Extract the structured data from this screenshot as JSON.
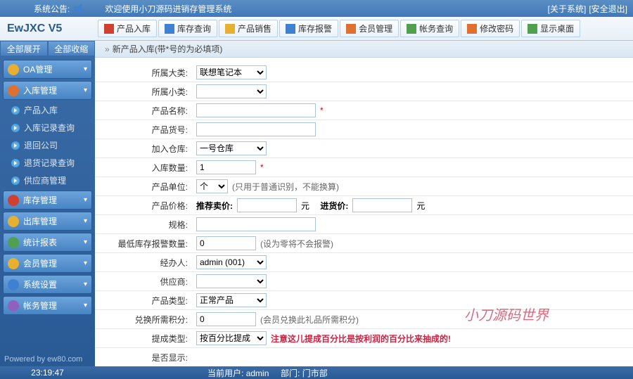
{
  "top": {
    "announce_label": "系统公告:",
    "welcome": "欢迎使用小刀源码进销存管理系统",
    "link_about": "[关于系统]",
    "link_exit": "[安全退出]"
  },
  "logo": "EwJXC  V5",
  "toolbar": [
    {
      "label": "产品入库",
      "name": "tb-product-in"
    },
    {
      "label": "库存查询",
      "name": "tb-stock-query"
    },
    {
      "label": "产品销售",
      "name": "tb-product-sale"
    },
    {
      "label": "库存报警",
      "name": "tb-stock-alarm"
    },
    {
      "label": "会员管理",
      "name": "tb-member"
    },
    {
      "label": "帐务查询",
      "name": "tb-account-query"
    },
    {
      "label": "修改密码",
      "name": "tb-change-pwd"
    },
    {
      "label": "显示桌面",
      "name": "tb-show-desktop"
    }
  ],
  "sb_toggle": {
    "expand": "全部展开",
    "collapse": "全部收缩"
  },
  "sidebar": [
    {
      "type": "group",
      "label": "OA管理",
      "name": "sb-oa"
    },
    {
      "type": "group",
      "label": "入库管理",
      "name": "sb-in"
    },
    {
      "type": "item",
      "label": "产品入库",
      "name": "sb-product-in"
    },
    {
      "type": "item",
      "label": "入库记录查询",
      "name": "sb-in-records"
    },
    {
      "type": "item",
      "label": "退回公司",
      "name": "sb-return"
    },
    {
      "type": "item",
      "label": "退货记录查询",
      "name": "sb-return-records"
    },
    {
      "type": "item",
      "label": "供应商管理",
      "name": "sb-supplier"
    },
    {
      "type": "group",
      "label": "库存管理",
      "name": "sb-stock"
    },
    {
      "type": "group",
      "label": "出库管理",
      "name": "sb-out"
    },
    {
      "type": "group",
      "label": "统计报表",
      "name": "sb-report"
    },
    {
      "type": "group",
      "label": "会员管理",
      "name": "sb-member"
    },
    {
      "type": "group",
      "label": "系统设置",
      "name": "sb-settings"
    },
    {
      "type": "group",
      "label": "帐务管理",
      "name": "sb-account"
    }
  ],
  "powered": "Powered by  ew80.com",
  "bread": {
    "title": "新产品入库(带*号的为必填项)"
  },
  "form": {
    "big_cat": {
      "label": "所属大类:",
      "value": "联想笔记本"
    },
    "small_cat": {
      "label": "所属小类:",
      "value": ""
    },
    "pname": {
      "label": "产品名称:",
      "value": ""
    },
    "pcode": {
      "label": "产品货号:",
      "value": ""
    },
    "warehouse": {
      "label": "加入仓库:",
      "value": "一号仓库"
    },
    "qty": {
      "label": "入库数量:",
      "value": "1"
    },
    "unit": {
      "label": "产品单位:",
      "value": "个",
      "hint": "(只用于普通识别，不能换算)"
    },
    "price": {
      "label": "产品价格:",
      "sale_lbl": "推荐卖价:",
      "sale_unit": "元",
      "buy_lbl": "进货价:",
      "buy_unit": "元"
    },
    "spec": {
      "label": "规格:",
      "value": ""
    },
    "min": {
      "label": "最低库存报警数量:",
      "value": "0",
      "hint": "(设为零将不会报警)"
    },
    "handler": {
      "label": "经办人:",
      "value": "admin (001)"
    },
    "supplier": {
      "label": "供应商:",
      "value": ""
    },
    "ptype": {
      "label": "产品类型:",
      "value": "正常产品"
    },
    "points": {
      "label": "兑换所需积分:",
      "value": "0",
      "hint": "(会员兑换此礼品所需积分)"
    },
    "bonus_type": {
      "label": "提成类型:",
      "value": "按百分比提成",
      "hint": "注意这儿提成百分比是按利润的百分比来抽成的!"
    },
    "display": {
      "label": "是否显示:",
      "value": ""
    }
  },
  "watermark": "小刀源码世界",
  "status": {
    "time": "23:19:47",
    "user_lbl": "当前用户:",
    "user": "admin",
    "dept_lbl": "部门:",
    "dept": "门市部"
  }
}
